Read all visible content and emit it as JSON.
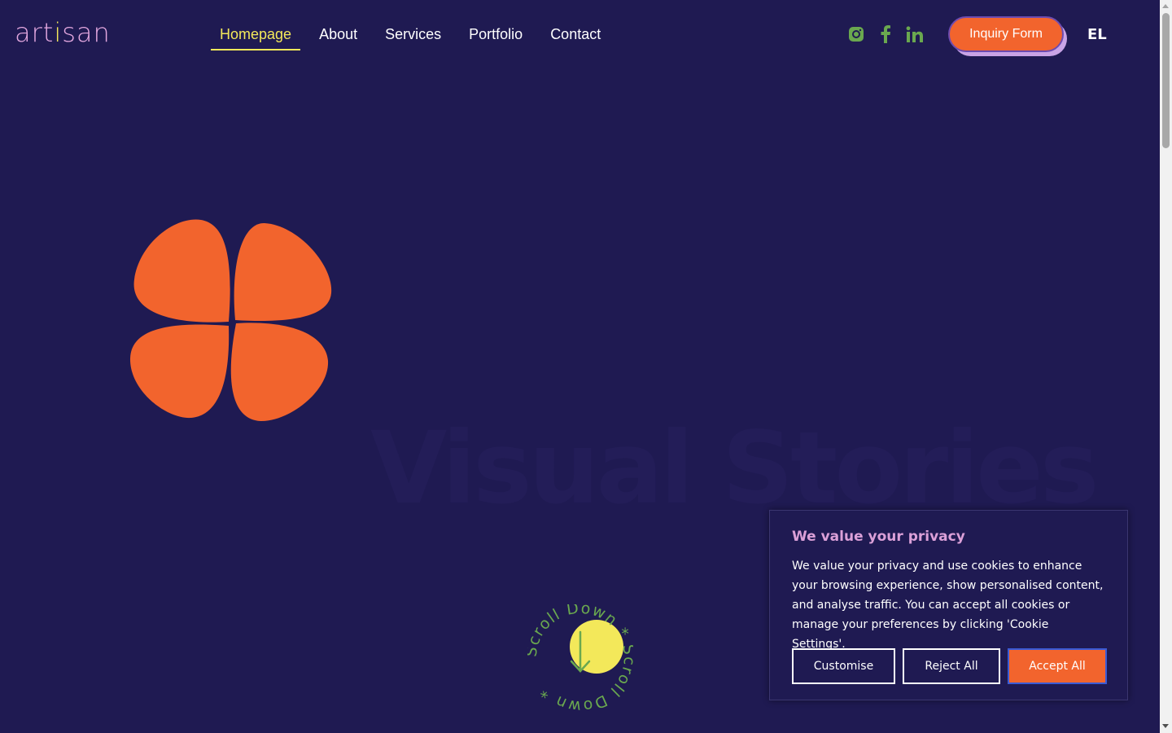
{
  "header": {
    "logo": {
      "part1": "art",
      "part2": "i",
      "part3": "san"
    },
    "nav": [
      {
        "label": "Homepage",
        "active": true
      },
      {
        "label": "About",
        "active": false
      },
      {
        "label": "Services",
        "active": false
      },
      {
        "label": "Portfolio",
        "active": false
      },
      {
        "label": "Contact",
        "active": false
      }
    ],
    "socials": [
      "instagram-icon",
      "facebook-icon",
      "linkedin-icon"
    ],
    "inquiry_label": "Inquiry Form",
    "language": "EL"
  },
  "hero": {
    "title": "Visual Stories",
    "scroll_text": "Scroll Down * Scroll Down *"
  },
  "cookie": {
    "title": "We value your privacy",
    "text": "We value your privacy and use cookies to enhance your browsing experience, show personalised content, and analyse traffic. You can accept all cookies or manage your preferences by clicking 'Cookie Settings'.",
    "customise_label": "Customise",
    "reject_label": "Reject All",
    "accept_label": "Accept All"
  },
  "colors": {
    "background": "#1f1a52",
    "accent_orange": "#f2642d",
    "accent_yellow": "#f3e85a",
    "accent_pink": "#dba0d8",
    "social_green": "#6aa84f"
  }
}
